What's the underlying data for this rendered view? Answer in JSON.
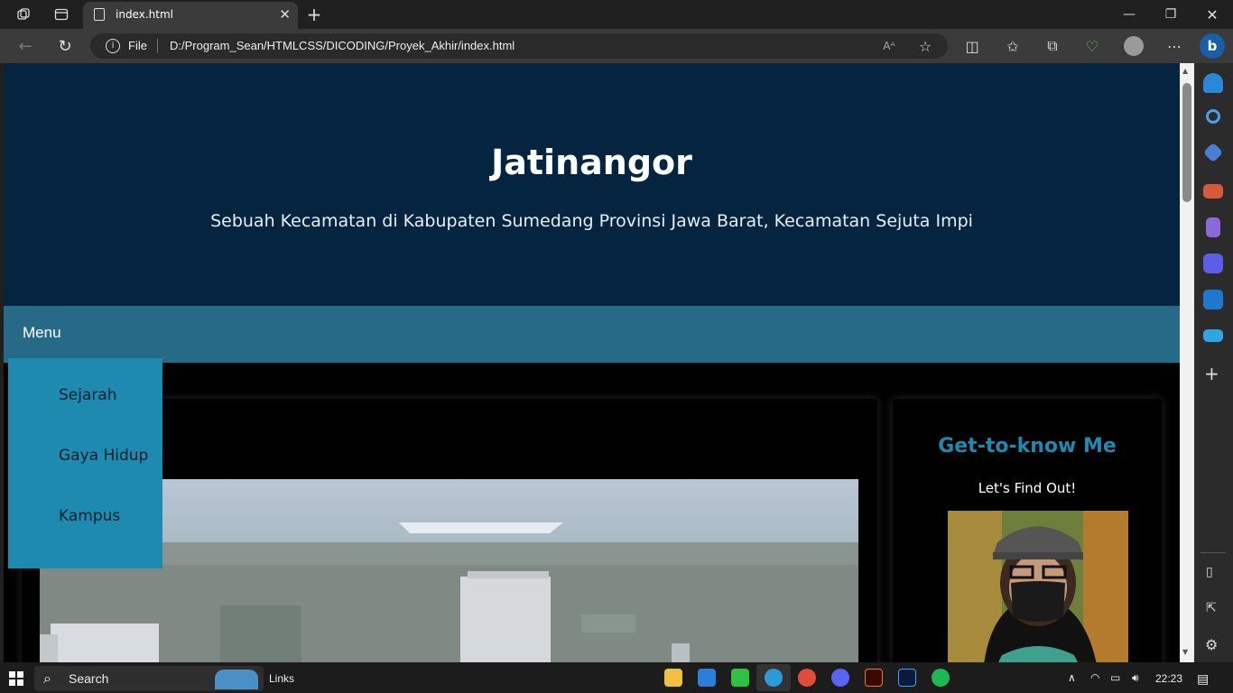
{
  "browser": {
    "tab_title": "index.html",
    "address_prefix": "File",
    "url": "D:/Program_Sean/HTMLCSS/DICODING/Proyek_Akhir/index.html",
    "new_tab_icon": "plus-icon"
  },
  "page": {
    "title": "Jatinangor",
    "subtitle": "Sebuah Kecamatan di Kabupaten Sumedang Provinsi Jawa Barat, Kecamatan Sejuta Impi",
    "nav_label": "Menu",
    "dropdown": [
      "Sejarah",
      "Gaya Hidup",
      "Kampus"
    ],
    "aside": {
      "heading": "Get-to-know Me",
      "tagline": "Let's Find Out!"
    }
  },
  "taskbar": {
    "search_label": "Search",
    "widget_label": "Links",
    "time": "22:23"
  },
  "colors": {
    "hero_bg": "#042440",
    "nav_bg": "#266a87",
    "dropdown_bg": "#1e8ab0",
    "accent": "#1e8ab0"
  }
}
